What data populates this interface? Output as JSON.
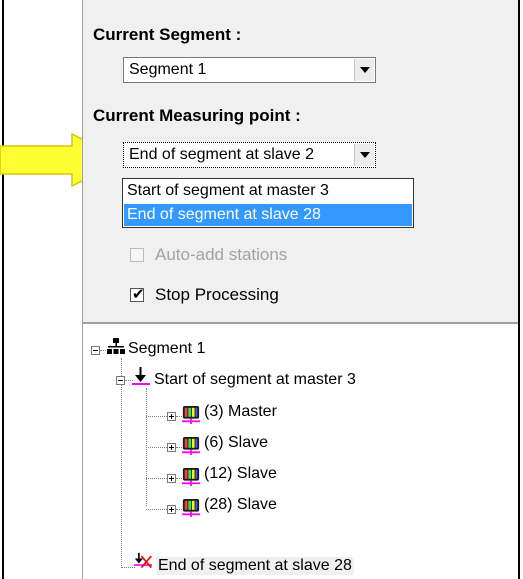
{
  "panel": {
    "current_segment_label": "Current Segment :",
    "current_segment_value": "Segment 1",
    "current_measuring_label": "Current Measuring point :",
    "current_measuring_value": "End of segment at slave 2",
    "dropdown_options": [
      "Start of segment at master 3",
      "End of segment at slave 28"
    ],
    "dropdown_selected_index": 1,
    "auto_add_label": "Auto-add stations",
    "auto_add_checked": false,
    "auto_add_enabled": false,
    "stop_processing_label": "Stop Processing",
    "stop_processing_checked": true
  },
  "tree": {
    "root": "Segment 1",
    "start_node": "Start of segment at master 3",
    "devices": [
      "(3) Master",
      "(6) Slave",
      "(12) Slave",
      "(28) Slave"
    ],
    "end_node": "End of segment at slave 28"
  },
  "colors": {
    "annotation_arrow": "#ffff33",
    "selection": "#3399ff",
    "marker_magenta": "#ff00ff",
    "end_x_red": "#ff0000"
  }
}
